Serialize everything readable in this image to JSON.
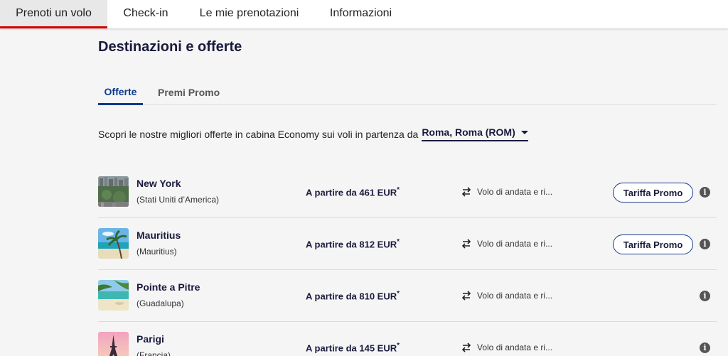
{
  "topnav": {
    "tabs": [
      {
        "label": "Prenoti un volo"
      },
      {
        "label": "Check-in"
      },
      {
        "label": "Le mie prenotazioni"
      },
      {
        "label": "Informazioni"
      }
    ],
    "active_index": 0,
    "accent": "#d40000"
  },
  "section": {
    "title": "Destinazioni e offerte",
    "tabs": [
      {
        "label": "Offerte"
      },
      {
        "label": "Premi Promo"
      }
    ],
    "active_tab": 0
  },
  "intro": {
    "text": "Scopri le nostre migliori offerte in cabina Economy sui voli in partenza da",
    "origin": "Roma, Roma (ROM)"
  },
  "offers": [
    {
      "city": "New York",
      "country": "(Stati Uniti d’America)",
      "price": "A partire da 461 EUR",
      "price_mark": "*",
      "trip": "Volo di andata e ri...",
      "promo_label": "Tariffa Promo",
      "image": "central-park-aerial"
    },
    {
      "city": "Mauritius",
      "country": "(Mauritius)",
      "price": "A partire da 812 EUR",
      "price_mark": "*",
      "trip": "Volo di andata e ri...",
      "promo_label": "Tariffa Promo",
      "image": "tropical-beach-palm"
    },
    {
      "city": "Pointe a Pitre",
      "country": "(Guadalupa)",
      "price": "A partire da 810 EUR",
      "price_mark": "*",
      "trip": "Volo di andata e ri...",
      "promo_label": "",
      "image": "caribbean-beach"
    },
    {
      "city": "Parigi",
      "country": "(Francia)",
      "price": "A partire da 145 EUR",
      "price_mark": "*",
      "trip": "Volo di andata e ri...",
      "promo_label": "",
      "image": "eiffel-tower-sunset"
    }
  ],
  "colors": {
    "brand_navy": "#1a1a3e",
    "tab_active": "#0b3a8c",
    "background": "#f5f5f5"
  }
}
